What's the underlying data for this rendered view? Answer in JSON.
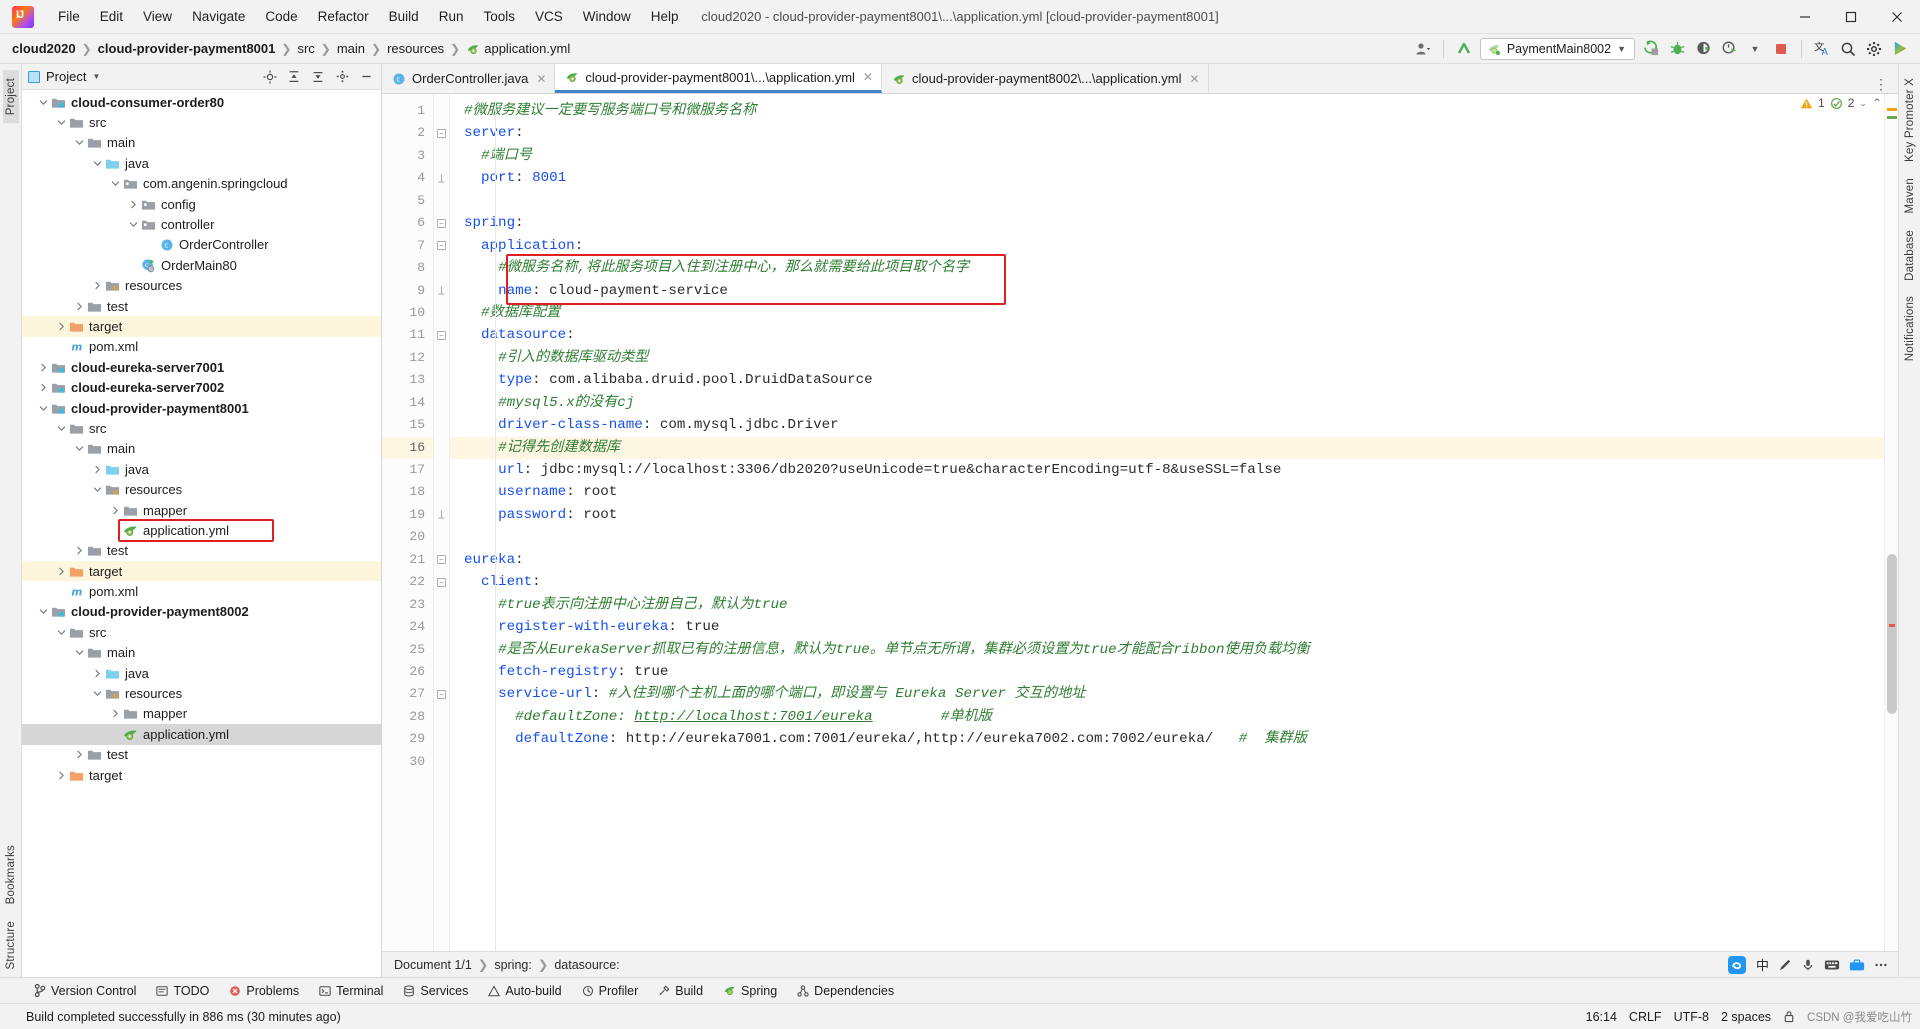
{
  "window": {
    "title": "cloud2020 - cloud-provider-payment8001\\...\\application.yml [cloud-provider-payment8001]",
    "minimize": "—",
    "maximize": "▢",
    "close": "✕"
  },
  "menubar": [
    {
      "label": "File"
    },
    {
      "label": "Edit"
    },
    {
      "label": "View"
    },
    {
      "label": "Navigate"
    },
    {
      "label": "Code"
    },
    {
      "label": "Refactor"
    },
    {
      "label": "Build"
    },
    {
      "label": "Run"
    },
    {
      "label": "Tools"
    },
    {
      "label": "VCS"
    },
    {
      "label": "Window"
    },
    {
      "label": "Help"
    }
  ],
  "breadcrumb_nav": [
    {
      "label": "cloud2020",
      "bold": true
    },
    {
      "label": "cloud-provider-payment8001",
      "bold": true
    },
    {
      "label": "src",
      "bold": false
    },
    {
      "label": "main",
      "bold": false
    },
    {
      "label": "resources",
      "bold": false
    },
    {
      "label": "application.yml",
      "bold": false
    }
  ],
  "toolbar": {
    "run_config": "PaymentMain8002",
    "icons": [
      "user-avatar-icon",
      "update-project-icon",
      "run-icon",
      "debug-icon",
      "coverage-icon",
      "profile-icon",
      "stop-icon",
      "translate-icon",
      "search-everywhere-icon",
      "settings-icon",
      "ide-feature-icon"
    ]
  },
  "project_panel": {
    "title": "Project",
    "header_icons": [
      "locate-icon",
      "expand-all-icon",
      "collapse-all-icon",
      "settings-icon",
      "hide-icon"
    ],
    "tree": [
      {
        "depth": 1,
        "label": "cloud-consumer-order80",
        "icon": "module-folder",
        "arrow": "down",
        "bold": true
      },
      {
        "depth": 2,
        "label": "src",
        "icon": "folder",
        "arrow": "down",
        "bold": false
      },
      {
        "depth": 3,
        "label": "main",
        "icon": "folder",
        "arrow": "down",
        "bold": false
      },
      {
        "depth": 4,
        "label": "java",
        "icon": "source-folder",
        "arrow": "down",
        "bold": false
      },
      {
        "depth": 5,
        "label": "com.angenin.springcloud",
        "icon": "package",
        "arrow": "down",
        "bold": false
      },
      {
        "depth": 6,
        "label": "config",
        "icon": "package",
        "arrow": "right",
        "bold": false
      },
      {
        "depth": 6,
        "label": "controller",
        "icon": "package",
        "arrow": "down",
        "bold": false
      },
      {
        "depth": 7,
        "label": "OrderController",
        "icon": "class",
        "arrow": "none",
        "bold": false
      },
      {
        "depth": 6,
        "label": "OrderMain80",
        "icon": "runnable-class",
        "arrow": "none",
        "bold": false
      },
      {
        "depth": 4,
        "label": "resources",
        "icon": "resource-folder",
        "arrow": "right",
        "bold": false
      },
      {
        "depth": 3,
        "label": "test",
        "icon": "folder",
        "arrow": "right",
        "bold": false
      },
      {
        "depth": 2,
        "label": "target",
        "icon": "excluded-folder",
        "arrow": "right",
        "bold": false,
        "highlight": "yellow"
      },
      {
        "depth": 2,
        "label": "pom.xml",
        "icon": "maven",
        "arrow": "none",
        "bold": false
      },
      {
        "depth": 1,
        "label": "cloud-eureka-server7001",
        "icon": "module-folder",
        "arrow": "right",
        "bold": true
      },
      {
        "depth": 1,
        "label": "cloud-eureka-server7002",
        "icon": "module-folder",
        "arrow": "right",
        "bold": true
      },
      {
        "depth": 1,
        "label": "cloud-provider-payment8001",
        "icon": "module-folder",
        "arrow": "down",
        "bold": true
      },
      {
        "depth": 2,
        "label": "src",
        "icon": "folder",
        "arrow": "down",
        "bold": false
      },
      {
        "depth": 3,
        "label": "main",
        "icon": "folder",
        "arrow": "down",
        "bold": false
      },
      {
        "depth": 4,
        "label": "java",
        "icon": "source-folder",
        "arrow": "right",
        "bold": false
      },
      {
        "depth": 4,
        "label": "resources",
        "icon": "resource-folder",
        "arrow": "down",
        "bold": false
      },
      {
        "depth": 5,
        "label": "mapper",
        "icon": "folder",
        "arrow": "right",
        "bold": false
      },
      {
        "depth": 5,
        "label": "application.yml",
        "icon": "yml",
        "arrow": "none",
        "bold": false,
        "redbox": true
      },
      {
        "depth": 3,
        "label": "test",
        "icon": "folder",
        "arrow": "right",
        "bold": false
      },
      {
        "depth": 2,
        "label": "target",
        "icon": "excluded-folder",
        "arrow": "right",
        "bold": false,
        "highlight": "yellow"
      },
      {
        "depth": 2,
        "label": "pom.xml",
        "icon": "maven",
        "arrow": "none",
        "bold": false
      },
      {
        "depth": 1,
        "label": "cloud-provider-payment8002",
        "icon": "module-folder",
        "arrow": "down",
        "bold": true
      },
      {
        "depth": 2,
        "label": "src",
        "icon": "folder",
        "arrow": "down",
        "bold": false
      },
      {
        "depth": 3,
        "label": "main",
        "icon": "folder",
        "arrow": "down",
        "bold": false
      },
      {
        "depth": 4,
        "label": "java",
        "icon": "source-folder",
        "arrow": "right",
        "bold": false
      },
      {
        "depth": 4,
        "label": "resources",
        "icon": "resource-folder",
        "arrow": "down",
        "bold": false
      },
      {
        "depth": 5,
        "label": "mapper",
        "icon": "folder",
        "arrow": "right",
        "bold": false
      },
      {
        "depth": 5,
        "label": "application.yml",
        "icon": "yml",
        "arrow": "none",
        "bold": false,
        "highlight": "gray"
      },
      {
        "depth": 3,
        "label": "test",
        "icon": "folder",
        "arrow": "right",
        "bold": false
      },
      {
        "depth": 2,
        "label": "target",
        "icon": "excluded-folder",
        "arrow": "right",
        "bold": false
      }
    ]
  },
  "left_strip": [
    {
      "label": "Project",
      "active": true
    },
    {
      "label": "Bookmarks",
      "active": false
    },
    {
      "label": "Structure",
      "active": false
    }
  ],
  "right_strip": [
    {
      "label": "Key Promoter X"
    },
    {
      "label": "Maven"
    },
    {
      "label": "Database"
    },
    {
      "label": "Notifications"
    }
  ],
  "editor_tabs": [
    {
      "label": "OrderController.java",
      "icon": "java-class-icon",
      "active": false
    },
    {
      "label": "cloud-provider-payment8001\\...\\application.yml",
      "icon": "yml-icon",
      "active": true
    },
    {
      "label": "cloud-provider-payment8002\\...\\application.yml",
      "icon": "yml-icon",
      "active": false
    }
  ],
  "inspections": {
    "warnings": "1",
    "weak_warnings": "2"
  },
  "code": {
    "lines": [
      {
        "n": "1",
        "fold": "none",
        "cur": false,
        "tokens": [
          {
            "t": "#微服务建议一定要写服务端口号和微服务名称",
            "c": "c"
          }
        ]
      },
      {
        "n": "2",
        "fold": "top",
        "cur": false,
        "tokens": [
          {
            "t": "server",
            "c": "k"
          },
          {
            "t": ":",
            "c": "p"
          }
        ]
      },
      {
        "n": "3",
        "fold": "none",
        "cur": false,
        "tokens": [
          {
            "t": "  ",
            "c": "p"
          },
          {
            "t": "#端口号",
            "c": "c"
          }
        ]
      },
      {
        "n": "4",
        "fold": "end",
        "cur": false,
        "tokens": [
          {
            "t": "  ",
            "c": "p"
          },
          {
            "t": "port",
            "c": "k"
          },
          {
            "t": ": ",
            "c": "p"
          },
          {
            "t": "8001",
            "c": "n"
          }
        ]
      },
      {
        "n": "5",
        "fold": "none",
        "cur": false,
        "tokens": []
      },
      {
        "n": "6",
        "fold": "top",
        "cur": false,
        "tokens": [
          {
            "t": "spring",
            "c": "k"
          },
          {
            "t": ":",
            "c": "p"
          }
        ]
      },
      {
        "n": "7",
        "fold": "top",
        "cur": false,
        "tokens": [
          {
            "t": "  ",
            "c": "p"
          },
          {
            "t": "application",
            "c": "k"
          },
          {
            "t": ":",
            "c": "p"
          }
        ]
      },
      {
        "n": "8",
        "fold": "none",
        "cur": false,
        "tokens": [
          {
            "t": "    ",
            "c": "p"
          },
          {
            "t": "#微服务名称,将此服务项目入住到注册中心，那么就需要给此项目取个名字",
            "c": "c"
          }
        ]
      },
      {
        "n": "9",
        "fold": "end",
        "cur": false,
        "tokens": [
          {
            "t": "    ",
            "c": "p"
          },
          {
            "t": "name",
            "c": "k"
          },
          {
            "t": ": ",
            "c": "p"
          },
          {
            "t": "cloud-payment-service",
            "c": "p"
          }
        ]
      },
      {
        "n": "10",
        "fold": "none",
        "cur": false,
        "tokens": [
          {
            "t": "  ",
            "c": "p"
          },
          {
            "t": "#数据库配置",
            "c": "c"
          }
        ]
      },
      {
        "n": "11",
        "fold": "top",
        "cur": false,
        "tokens": [
          {
            "t": "  ",
            "c": "p"
          },
          {
            "t": "datasource",
            "c": "k"
          },
          {
            "t": ":",
            "c": "p"
          }
        ]
      },
      {
        "n": "12",
        "fold": "none",
        "cur": false,
        "tokens": [
          {
            "t": "    ",
            "c": "p"
          },
          {
            "t": "#引入的数据库驱动类型",
            "c": "c"
          }
        ]
      },
      {
        "n": "13",
        "fold": "none",
        "cur": false,
        "tokens": [
          {
            "t": "    ",
            "c": "p"
          },
          {
            "t": "type",
            "c": "k"
          },
          {
            "t": ": ",
            "c": "p"
          },
          {
            "t": "com.alibaba.druid.pool.DruidDataSource",
            "c": "p"
          }
        ]
      },
      {
        "n": "14",
        "fold": "none",
        "cur": false,
        "tokens": [
          {
            "t": "    ",
            "c": "p"
          },
          {
            "t": "#mysql5.x的没有cj",
            "c": "c"
          }
        ]
      },
      {
        "n": "15",
        "fold": "none",
        "cur": false,
        "tokens": [
          {
            "t": "    ",
            "c": "p"
          },
          {
            "t": "driver-class-name",
            "c": "k"
          },
          {
            "t": ": ",
            "c": "p"
          },
          {
            "t": "com.mysql.jdbc.Driver",
            "c": "p"
          }
        ]
      },
      {
        "n": "16",
        "fold": "none",
        "cur": true,
        "tokens": [
          {
            "t": "    ",
            "c": "p"
          },
          {
            "t": "#记得先创建数据库",
            "c": "c"
          }
        ]
      },
      {
        "n": "17",
        "fold": "none",
        "cur": false,
        "tokens": [
          {
            "t": "    ",
            "c": "p"
          },
          {
            "t": "url",
            "c": "k"
          },
          {
            "t": ": ",
            "c": "p"
          },
          {
            "t": "jdbc:mysql://localhost:3306/db2020?useUnicode=true&characterEncoding=utf-8&useSSL=false",
            "c": "p"
          }
        ]
      },
      {
        "n": "18",
        "fold": "none",
        "cur": false,
        "tokens": [
          {
            "t": "    ",
            "c": "p"
          },
          {
            "t": "username",
            "c": "k"
          },
          {
            "t": ": ",
            "c": "p"
          },
          {
            "t": "root",
            "c": "p"
          }
        ]
      },
      {
        "n": "19",
        "fold": "end",
        "cur": false,
        "tokens": [
          {
            "t": "    ",
            "c": "p"
          },
          {
            "t": "password",
            "c": "k"
          },
          {
            "t": ": ",
            "c": "p"
          },
          {
            "t": "root",
            "c": "p"
          }
        ]
      },
      {
        "n": "20",
        "fold": "none",
        "cur": false,
        "tokens": []
      },
      {
        "n": "21",
        "fold": "top",
        "cur": false,
        "tokens": [
          {
            "t": "eureka",
            "c": "k"
          },
          {
            "t": ":",
            "c": "p"
          }
        ]
      },
      {
        "n": "22",
        "fold": "top",
        "cur": false,
        "tokens": [
          {
            "t": "  ",
            "c": "p"
          },
          {
            "t": "client",
            "c": "k"
          },
          {
            "t": ":",
            "c": "p"
          }
        ]
      },
      {
        "n": "23",
        "fold": "none",
        "cur": false,
        "tokens": [
          {
            "t": "    ",
            "c": "p"
          },
          {
            "t": "#true表示向注册中心注册自己，默认为true",
            "c": "c"
          }
        ]
      },
      {
        "n": "24",
        "fold": "none",
        "cur": false,
        "tokens": [
          {
            "t": "    ",
            "c": "p"
          },
          {
            "t": "register-with-eureka",
            "c": "k"
          },
          {
            "t": ": ",
            "c": "p"
          },
          {
            "t": "true",
            "c": "p"
          }
        ]
      },
      {
        "n": "25",
        "fold": "none",
        "cur": false,
        "tokens": [
          {
            "t": "    ",
            "c": "p"
          },
          {
            "t": "#是否从EurekaServer抓取已有的注册信息，默认为true。单节点无所谓，集群必须设置为true才能配合ribbon使用负载均衡",
            "c": "c"
          }
        ]
      },
      {
        "n": "26",
        "fold": "none",
        "cur": false,
        "tokens": [
          {
            "t": "    ",
            "c": "p"
          },
          {
            "t": "fetch-registry",
            "c": "k"
          },
          {
            "t": ": ",
            "c": "p"
          },
          {
            "t": "true",
            "c": "p"
          }
        ]
      },
      {
        "n": "27",
        "fold": "top",
        "cur": false,
        "tokens": [
          {
            "t": "    ",
            "c": "p"
          },
          {
            "t": "service-url",
            "c": "k"
          },
          {
            "t": ": ",
            "c": "p"
          },
          {
            "t": "#入住到哪个主机上面的哪个端口，即设置与 Eureka Server 交互的地址",
            "c": "c"
          }
        ]
      },
      {
        "n": "28",
        "fold": "none",
        "cur": false,
        "tokens": [
          {
            "t": "      ",
            "c": "p"
          },
          {
            "t": "#defaultZone: ",
            "c": "c"
          },
          {
            "t": "http://localhost:7001/eureka",
            "c": "lnk"
          },
          {
            "t": "        ",
            "c": "p"
          },
          {
            "t": "#单机版",
            "c": "c"
          }
        ]
      },
      {
        "n": "29",
        "fold": "none",
        "cur": false,
        "tokens": [
          {
            "t": "      ",
            "c": "p"
          },
          {
            "t": "defaultZone",
            "c": "k"
          },
          {
            "t": ": ",
            "c": "p"
          },
          {
            "t": "http://eureka7001.com:7001/eureka/,http://eureka7002.com:7002/eureka/",
            "c": "p"
          },
          {
            "t": "   ",
            "c": "p"
          },
          {
            "t": "#  集群版",
            "c": "c"
          }
        ]
      },
      {
        "n": "30",
        "fold": "none",
        "cur": false,
        "tokens": []
      }
    ]
  },
  "editor_breadcrumb": {
    "document": "Document 1/1",
    "path": [
      "spring:",
      "datasource:"
    ]
  },
  "bottom_tools": [
    {
      "label": "Version Control",
      "icon": "branch-icon"
    },
    {
      "label": "TODO",
      "icon": "todo-icon"
    },
    {
      "label": "Problems",
      "icon": "problems-icon"
    },
    {
      "label": "Terminal",
      "icon": "terminal-icon"
    },
    {
      "label": "Services",
      "icon": "services-icon"
    },
    {
      "label": "Auto-build",
      "icon": "autobuild-icon"
    },
    {
      "label": "Profiler",
      "icon": "profiler-icon"
    },
    {
      "label": "Build",
      "icon": "build-icon"
    },
    {
      "label": "Spring",
      "icon": "spring-icon"
    },
    {
      "label": "Dependencies",
      "icon": "dependencies-icon"
    }
  ],
  "statusbar": {
    "message": "Build completed successfully in 886 ms (30 minutes ago)",
    "time": "16:14",
    "line_separator": "CRLF",
    "encoding": "UTF-8",
    "indent": "2 spaces",
    "lock": "lock-icon",
    "watermark": "CSDN @我爱吃山竹"
  },
  "colors": {
    "accent": "#4083c9",
    "highlight_box": "#e02020",
    "comment": "#2e7d32",
    "key": "#1750eb",
    "selected_row": "#fdf6dd"
  }
}
